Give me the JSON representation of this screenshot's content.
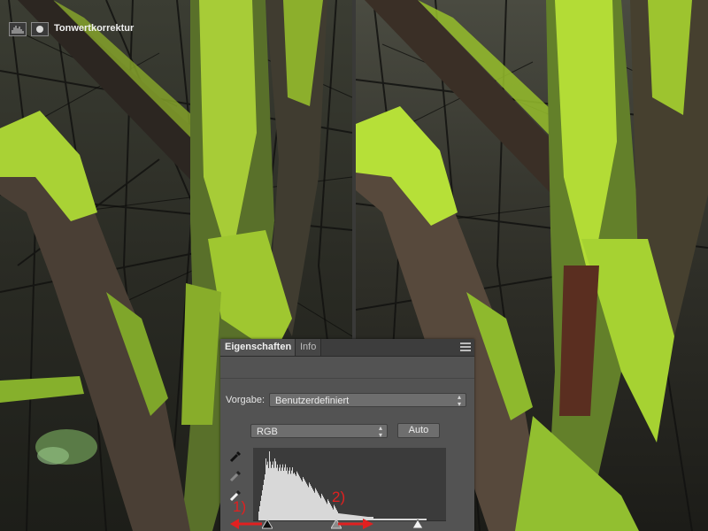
{
  "panel": {
    "tabs": [
      {
        "label": "Eigenschaften",
        "active": true
      },
      {
        "label": "Info",
        "active": false
      }
    ],
    "header_icons": [
      "histogram-icon",
      "mask-icon"
    ],
    "title": "Tonwertkorrektur",
    "preset_label": "Vorgabe:",
    "preset_value": "Benutzerdefiniert",
    "channel_value": "RGB",
    "auto_label": "Auto",
    "eyedroppers": [
      "black-point-eyedropper-icon",
      "gray-point-eyedropper-icon",
      "white-point-eyedropper-icon"
    ]
  },
  "annotations": [
    {
      "text": "1)",
      "color": "#e12020"
    },
    {
      "text": "2)",
      "color": "#e12020"
    }
  ],
  "colors": {
    "panel_bg": "#535353",
    "accent_red": "#e12020",
    "moss": "#8ab82a"
  }
}
